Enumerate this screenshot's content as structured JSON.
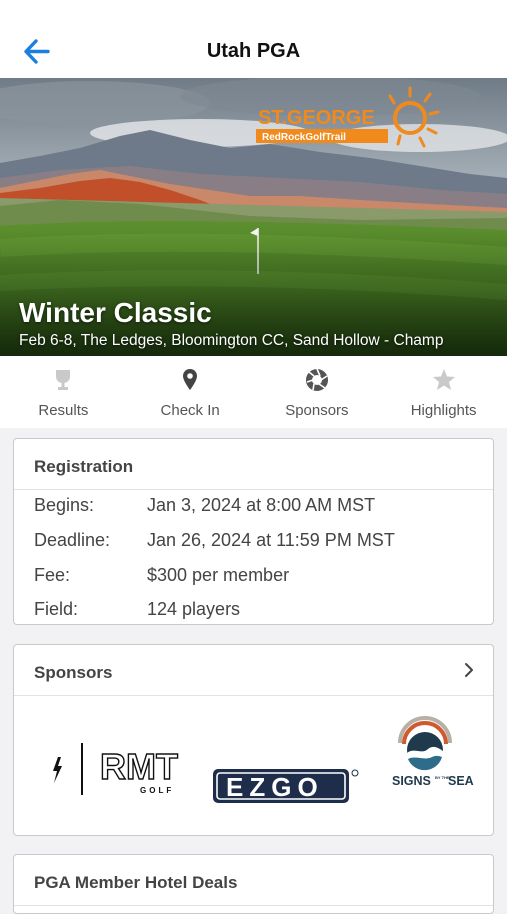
{
  "nav": {
    "title": "Utah PGA"
  },
  "hero": {
    "event_title": "Winter Classic",
    "event_subtitle": "Feb 6-8, The Ledges, Bloomington CC, Sand Hollow - Champ",
    "logo_line1": "ST.GEORGE",
    "logo_line2": "RedRockGolfTrail"
  },
  "tabs": [
    {
      "label": "Results",
      "icon": "trophy-icon"
    },
    {
      "label": "Check In",
      "icon": "map-pin-icon"
    },
    {
      "label": "Sponsors",
      "icon": "aperture-icon"
    },
    {
      "label": "Highlights",
      "icon": "star-icon"
    }
  ],
  "registration": {
    "title": "Registration",
    "rows": [
      {
        "label": "Begins:",
        "value": "Jan 3, 2024 at 8:00 AM MST"
      },
      {
        "label": "Deadline:",
        "value": "Jan 26, 2024 at 11:59 PM MST"
      },
      {
        "label": "Fee:",
        "value": "$300 per member"
      },
      {
        "label": "Field:",
        "value": "124 players"
      }
    ]
  },
  "sponsors": {
    "title": "Sponsors",
    "logos": [
      {
        "name": "RMT Golf",
        "text": "RMT",
        "sub": "GOLF"
      },
      {
        "name": "E-Z-GO",
        "text": "EZGO"
      },
      {
        "name": "Signs by the Sea",
        "text": "SIGNS",
        "sub": "BY THE",
        "text2": "SEA"
      }
    ]
  },
  "hotel": {
    "title": "PGA Member Hotel Deals"
  },
  "colors": {
    "accent": "#1b7fe0",
    "orange": "#f08a1c",
    "ezgo_navy": "#1d2d4a"
  }
}
